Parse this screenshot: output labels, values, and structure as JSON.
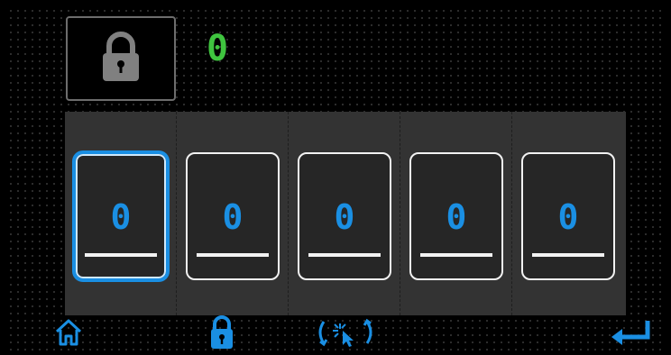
{
  "header": {
    "lock_icon": "lock-icon",
    "code_value": "0"
  },
  "digits": [
    {
      "value": "0",
      "selected": true
    },
    {
      "value": "0",
      "selected": false
    },
    {
      "value": "0",
      "selected": false
    },
    {
      "value": "0",
      "selected": false
    },
    {
      "value": "0",
      "selected": false
    }
  ],
  "nav": {
    "home_icon": "home-icon",
    "lock_icon": "lock-icon",
    "gesture_icon": "gesture-icon",
    "enter_icon": "enter-icon"
  },
  "colors": {
    "accent_blue": "#1a8fe3",
    "code_green": "#3fc43f",
    "panel_gray": "#333333",
    "lock_gray": "#808080"
  }
}
